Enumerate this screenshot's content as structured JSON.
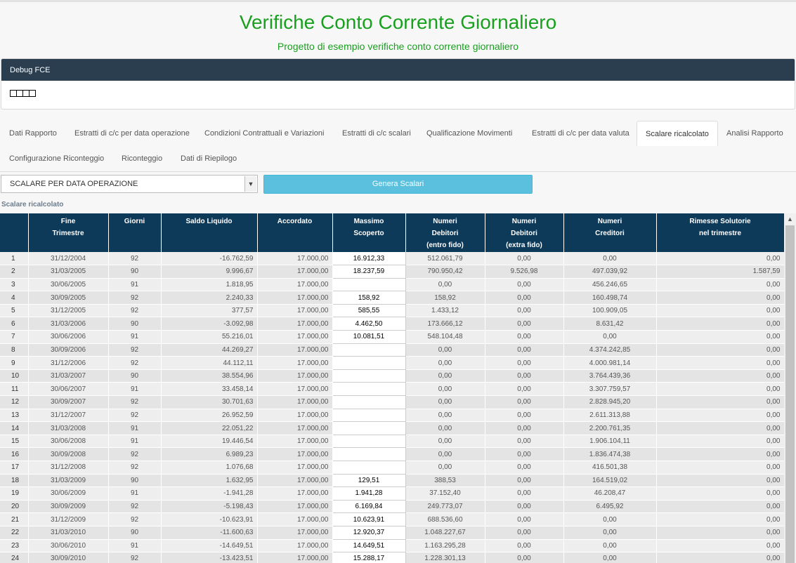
{
  "header": {
    "title": "Verifiche Conto Corrente Giornaliero",
    "subtitle": "Progetto di esempio verifiche conto corrente giornaliero"
  },
  "debug_panel": {
    "title": "Debug FCE"
  },
  "tabs": [
    "Dati Rapporto",
    "Estratti di c/c per data operazione",
    "Condizioni Contrattuali e Variazioni",
    "Estratti di c/c scalari",
    "Qualificazione Movimenti",
    "Estratti di c/c per data valuta",
    "Scalare ricalcolato",
    "Analisi Rapporto",
    "Configurazione Riconteggio",
    "Riconteggio",
    "Dati di Riepilogo"
  ],
  "active_tab": "Scalare ricalcolato",
  "controls": {
    "select_value": "SCALARE PER DATA OPERAZIONE",
    "generate_label": "Genera Scalari"
  },
  "section_label": "Scalare ricalcolato",
  "table": {
    "headers": [
      [
        ""
      ],
      [
        "Fine",
        "Trimestre"
      ],
      [
        "Giorni"
      ],
      [
        "Saldo Liquido"
      ],
      [
        "Accordato"
      ],
      [
        "Massimo",
        "Scoperto"
      ],
      [
        "Numeri",
        "Debitori",
        "(entro fido)"
      ],
      [
        "Numeri",
        "Debitori",
        "(extra fido)"
      ],
      [
        "Numeri",
        "Creditori"
      ],
      [
        "Rimesse Solutorie",
        "nel trimestre"
      ]
    ],
    "rows": [
      [
        "1",
        "31/12/2004",
        "92",
        "-16.762,59",
        "17.000,00",
        "16.912,33",
        "512.061,79",
        "0,00",
        "0,00",
        "0,00"
      ],
      [
        "2",
        "31/03/2005",
        "90",
        "9.996,67",
        "17.000,00",
        "18.237,59",
        "790.950,42",
        "9.526,98",
        "497.039,92",
        "1.587,59"
      ],
      [
        "3",
        "30/06/2005",
        "91",
        "1.818,95",
        "17.000,00",
        "",
        "0,00",
        "0,00",
        "456.246,65",
        "0,00"
      ],
      [
        "4",
        "30/09/2005",
        "92",
        "2.240,33",
        "17.000,00",
        "158,92",
        "158,92",
        "0,00",
        "160.498,74",
        "0,00"
      ],
      [
        "5",
        "31/12/2005",
        "92",
        "377,57",
        "17.000,00",
        "585,55",
        "1.433,12",
        "0,00",
        "100.909,05",
        "0,00"
      ],
      [
        "6",
        "31/03/2006",
        "90",
        "-3.092,98",
        "17.000,00",
        "4.462,50",
        "173.666,12",
        "0,00",
        "8.631,42",
        "0,00"
      ],
      [
        "7",
        "30/06/2006",
        "91",
        "55.216,01",
        "17.000,00",
        "10.081,51",
        "548.104,48",
        "0,00",
        "0,00",
        "0,00"
      ],
      [
        "8",
        "30/09/2006",
        "92",
        "44.269,27",
        "17.000,00",
        "",
        "0,00",
        "0,00",
        "4.374.242,85",
        "0,00"
      ],
      [
        "9",
        "31/12/2006",
        "92",
        "44.112,11",
        "17.000,00",
        "",
        "0,00",
        "0,00",
        "4.000.981,14",
        "0,00"
      ],
      [
        "10",
        "31/03/2007",
        "90",
        "38.554,96",
        "17.000,00",
        "",
        "0,00",
        "0,00",
        "3.764.439,36",
        "0,00"
      ],
      [
        "11",
        "30/06/2007",
        "91",
        "33.458,14",
        "17.000,00",
        "",
        "0,00",
        "0,00",
        "3.307.759,57",
        "0,00"
      ],
      [
        "12",
        "30/09/2007",
        "92",
        "30.701,63",
        "17.000,00",
        "",
        "0,00",
        "0,00",
        "2.828.945,20",
        "0,00"
      ],
      [
        "13",
        "31/12/2007",
        "92",
        "26.952,59",
        "17.000,00",
        "",
        "0,00",
        "0,00",
        "2.611.313,88",
        "0,00"
      ],
      [
        "14",
        "31/03/2008",
        "91",
        "22.051,22",
        "17.000,00",
        "",
        "0,00",
        "0,00",
        "2.200.761,35",
        "0,00"
      ],
      [
        "15",
        "30/06/2008",
        "91",
        "19.446,54",
        "17.000,00",
        "",
        "0,00",
        "0,00",
        "1.906.104,11",
        "0,00"
      ],
      [
        "16",
        "30/09/2008",
        "92",
        "6.989,23",
        "17.000,00",
        "",
        "0,00",
        "0,00",
        "1.836.474,38",
        "0,00"
      ],
      [
        "17",
        "31/12/2008",
        "92",
        "1.076,68",
        "17.000,00",
        "",
        "0,00",
        "0,00",
        "416.501,38",
        "0,00"
      ],
      [
        "18",
        "31/03/2009",
        "90",
        "1.632,95",
        "17.000,00",
        "129,51",
        "388,53",
        "0,00",
        "164.519,02",
        "0,00"
      ],
      [
        "19",
        "30/06/2009",
        "91",
        "-1.941,28",
        "17.000,00",
        "1.941,28",
        "37.152,40",
        "0,00",
        "46.208,47",
        "0,00"
      ],
      [
        "20",
        "30/09/2009",
        "92",
        "-5.198,43",
        "17.000,00",
        "6.169,84",
        "249.773,07",
        "0,00",
        "6.495,92",
        "0,00"
      ],
      [
        "21",
        "31/12/2009",
        "92",
        "-10.623,91",
        "17.000,00",
        "10.623,91",
        "688.536,60",
        "0,00",
        "0,00",
        "0,00"
      ],
      [
        "22",
        "31/03/2010",
        "90",
        "-11.600,63",
        "17.000,00",
        "12.920,37",
        "1.048.227,67",
        "0,00",
        "0,00",
        "0,00"
      ],
      [
        "23",
        "30/06/2010",
        "91",
        "-14.649,51",
        "17.000,00",
        "14.649,51",
        "1.163.295,28",
        "0,00",
        "0,00",
        "0,00"
      ],
      [
        "24",
        "30/09/2010",
        "92",
        "-13.423,51",
        "17.000,00",
        "15.288,17",
        "1.228.301,13",
        "0,00",
        "0,00",
        "0,00"
      ]
    ]
  },
  "icons": {
    "select_arrow": "chevron-down-icon",
    "scroll_up": "chevron-up-icon"
  }
}
